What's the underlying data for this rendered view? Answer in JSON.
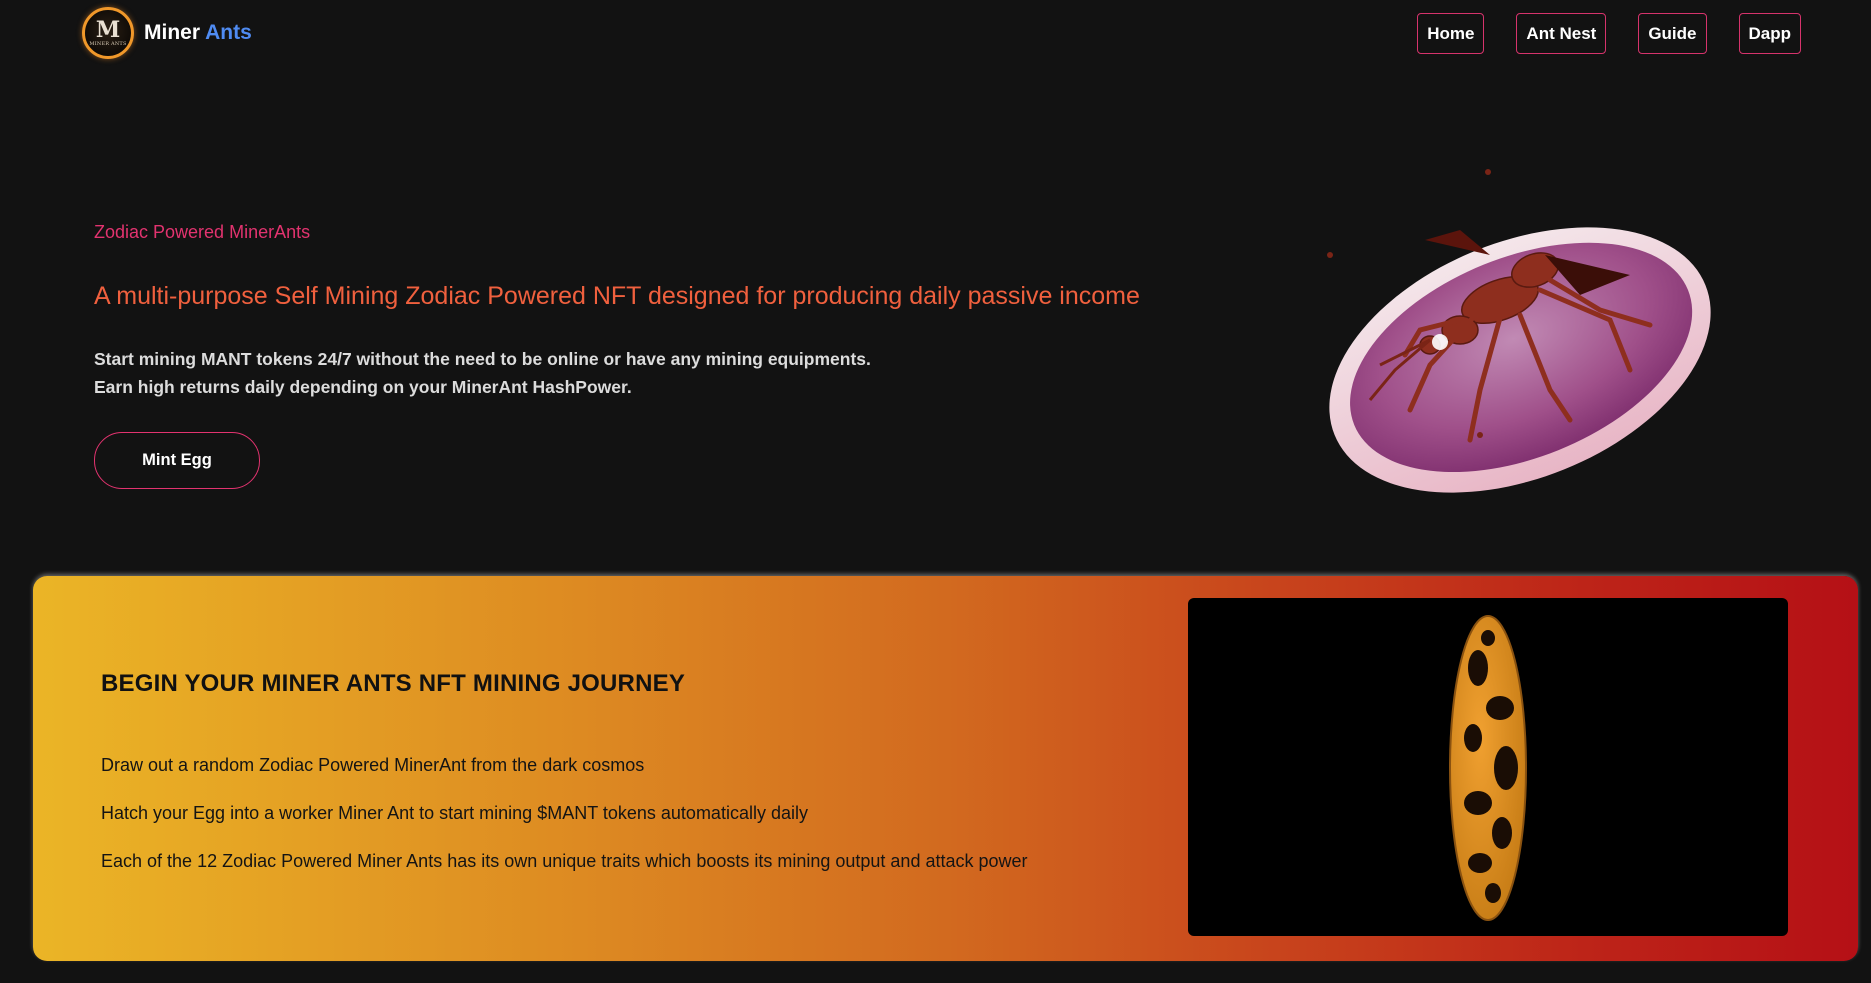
{
  "nav": {
    "logo_mark": "M",
    "logo_text": "MINER ANTS",
    "brand_first": "Miner",
    "brand_accent": "Ants",
    "links": [
      "Home",
      "Ant Nest",
      "Guide",
      "Dapp"
    ]
  },
  "hero": {
    "tag": "Zodiac Powered MinerAnts",
    "title": "A multi-purpose Self Mining Zodiac Powered NFT designed for producing daily passive income",
    "desc_line1": "Start mining MANT tokens 24/7 without the need to be online or have any mining equipments.",
    "desc_line2": "Earn high returns daily depending on your MinerAnt HashPower.",
    "cta": "Mint Egg"
  },
  "journey": {
    "title": "BEGIN YOUR MINER ANTS NFT MINING JOURNEY",
    "items": [
      "Draw out a random Zodiac Powered MinerAnt from the dark cosmos",
      "Hatch your Egg into a worker Miner Ant to start mining $MANT tokens automatically daily",
      "Each of the 12 Zodiac Powered Miner Ants has its own unique traits which boosts its mining output and attack power"
    ]
  },
  "colors": {
    "background": "#121212",
    "accent_pink": "#e2336f",
    "accent_orange": "#f0603e",
    "brand_blue": "#4f8bf2",
    "gradient_start": "#ebb526",
    "gradient_end": "#b51016"
  },
  "icons": {
    "logo": "miner-ants-logo",
    "hero_image": "ant-on-pink-disc",
    "video": "spotted-egg"
  }
}
